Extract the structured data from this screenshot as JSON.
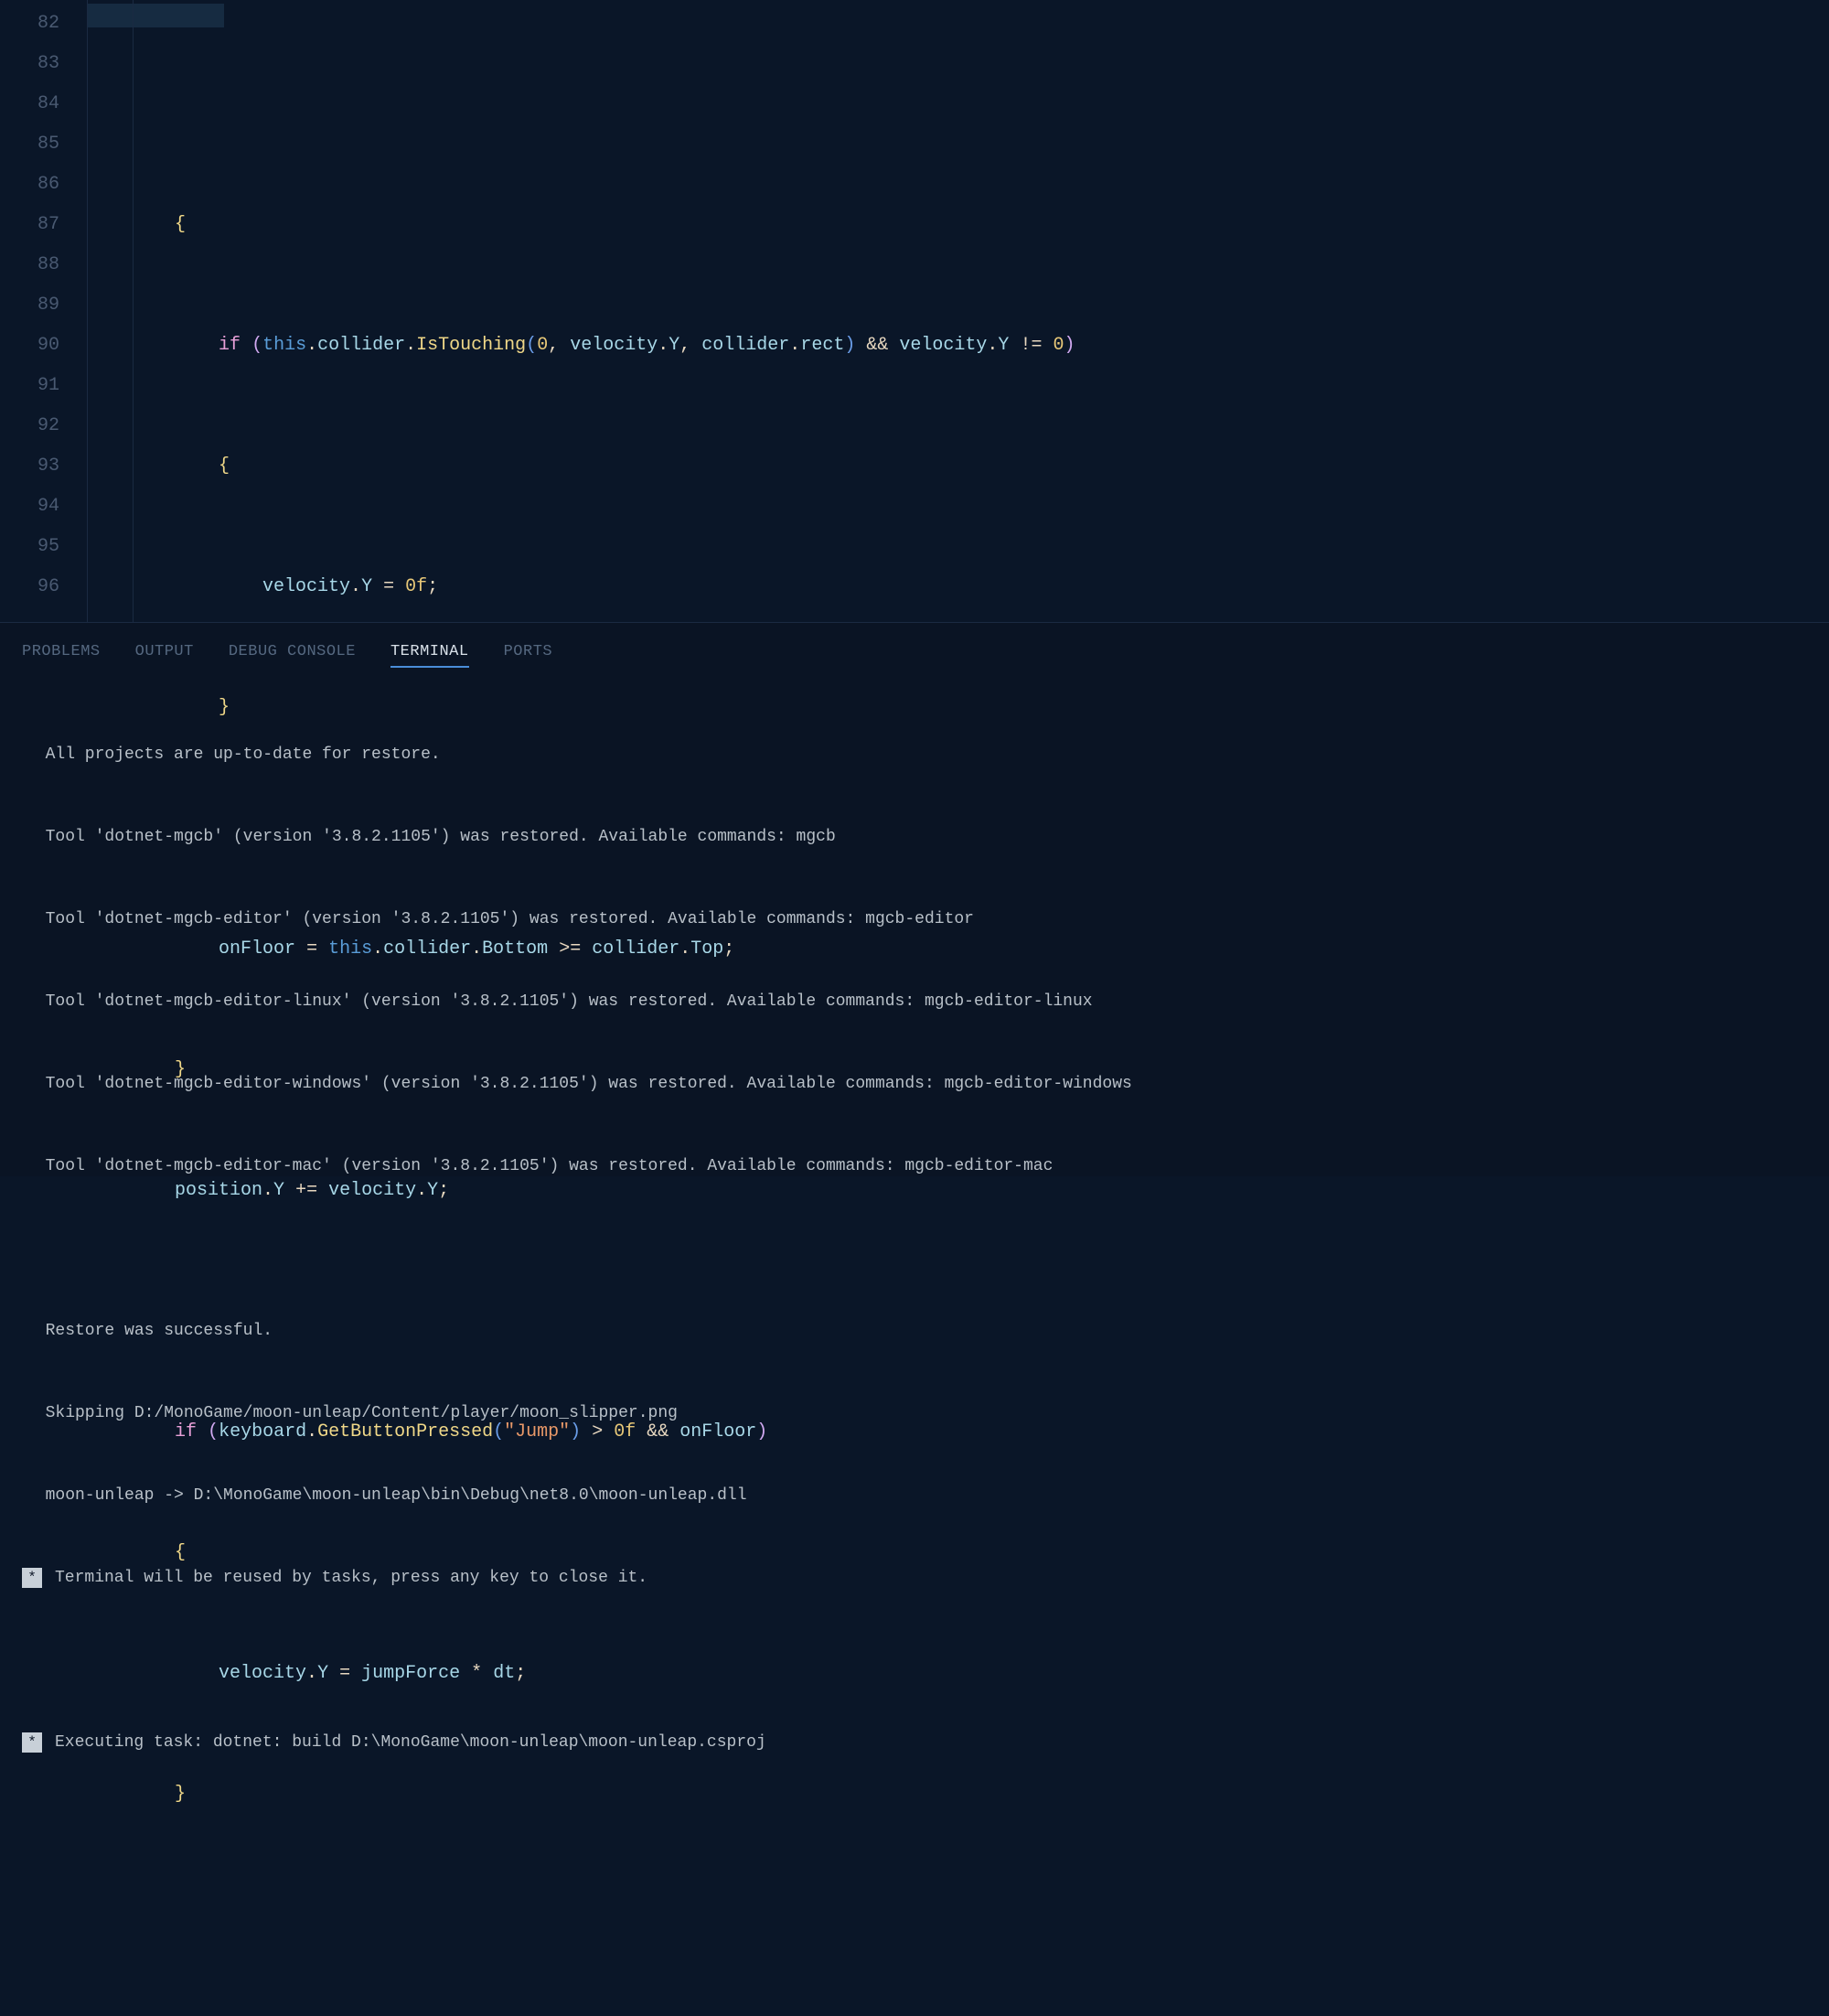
{
  "lineNumbers": [
    "82",
    "83",
    "84",
    "85",
    "86",
    "87",
    "88",
    "89",
    "90",
    "91",
    "92",
    "93",
    "94",
    "95",
    "96"
  ],
  "code": {
    "l82": "{",
    "l83": {
      "kw": "if",
      "this": "this",
      "collider": "collider",
      "isTouching": "IsTouching",
      "zero": "0",
      "velocity": "velocity",
      "Y": "Y",
      "rect": "rect",
      "neq": "!=",
      "zerob": "0",
      "and": "&&"
    },
    "l84": "{",
    "l85": {
      "velocity": "velocity",
      "Y": "Y",
      "eq": "=",
      "zerof": "0f"
    },
    "l86": "}",
    "l88": {
      "onFloor": "onFloor",
      "eq": "=",
      "this": "this",
      "collider": "collider",
      "Bottom": "Bottom",
      "ge": ">=",
      "Top": "Top"
    },
    "l89": "}",
    "l90": {
      "position": "position",
      "Y": "Y",
      "pluseq": "+=",
      "velocity": "velocity"
    },
    "l92": {
      "kw": "if",
      "keyboard": "keyboard",
      "GetButtonPressed": "GetButtonPressed",
      "jump": "\"Jump\"",
      "gt": ">",
      "zerof": "0f",
      "and": "&&",
      "onFloor": "onFloor"
    },
    "l93": "{",
    "l94": {
      "velocity": "velocity",
      "Y": "Y",
      "eq": "=",
      "jumpForce": "jumpForce",
      "mul": "*",
      "dt": "dt"
    },
    "l95": "}"
  },
  "tabs": {
    "problems": "PROBLEMS",
    "output": "OUTPUT",
    "debug": "DEBUG CONSOLE",
    "terminal": "TERMINAL",
    "ports": "PORTS"
  },
  "terminal": {
    "l1": "  All projects are up-to-date for restore.",
    "l2": "  Tool 'dotnet-mgcb' (version '3.8.2.1105') was restored. Available commands: mgcb",
    "l3": "  Tool 'dotnet-mgcb-editor' (version '3.8.2.1105') was restored. Available commands: mgcb-editor",
    "l4": "  Tool 'dotnet-mgcb-editor-linux' (version '3.8.2.1105') was restored. Available commands: mgcb-editor-linux",
    "l5": "  Tool 'dotnet-mgcb-editor-windows' (version '3.8.2.1105') was restored. Available commands: mgcb-editor-windows",
    "l6": "  Tool 'dotnet-mgcb-editor-mac' (version '3.8.2.1105') was restored. Available commands: mgcb-editor-mac",
    "l7": "  Restore was successful.",
    "l8": "  Skipping D:/MonoGame/moon-unleap/Content/player/moon_slipper.png",
    "l9": "  moon-unleap -> D:\\MonoGame\\moon-unleap\\bin\\Debug\\net8.0\\moon-unleap.dll",
    "l10": "Terminal will be reused by tasks, press any key to close it.",
    "l11": "Executing task: dotnet: build D:\\MonoGame\\moon-unleap\\moon-unleap.csproj",
    "marker": "*"
  }
}
